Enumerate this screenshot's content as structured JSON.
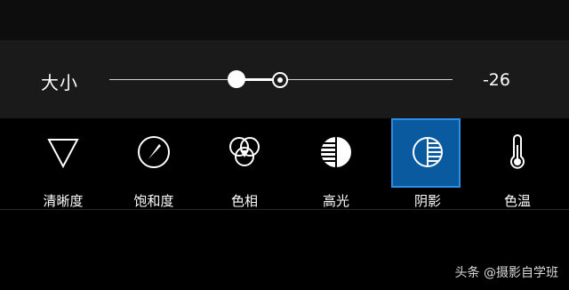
{
  "slider": {
    "label": "大小",
    "value": "-26",
    "level": 0.37,
    "origin": 0.5
  },
  "tools": [
    {
      "label": "清晰度",
      "icon": "triangle-icon",
      "selected": false
    },
    {
      "label": "饱和度",
      "icon": "gauge-icon",
      "selected": false
    },
    {
      "label": "色相",
      "icon": "hue-circles-icon",
      "selected": false
    },
    {
      "label": "高光",
      "icon": "highlights-icon",
      "selected": false
    },
    {
      "label": "阴影",
      "icon": "shadows-icon",
      "selected": true
    },
    {
      "label": "色温",
      "icon": "thermometer-icon",
      "selected": false
    }
  ],
  "colors": {
    "selected_bg": "#0a5aa0",
    "selected_border": "#2e8ee6",
    "panel_bg": "#1a1a1a"
  },
  "watermark": "头条 @摄影自学班"
}
